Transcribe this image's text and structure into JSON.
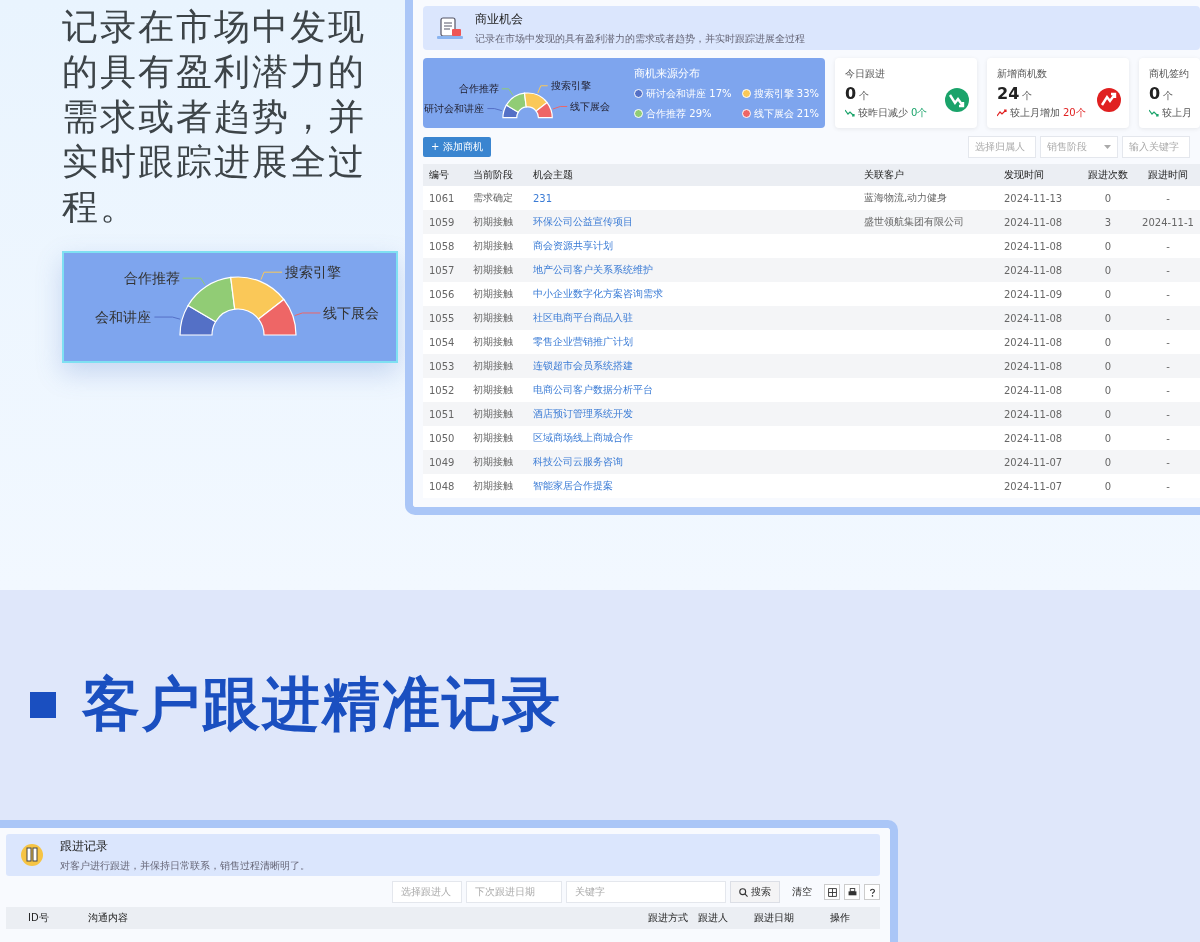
{
  "intro": {
    "text": "记录在市场中发现的具有盈利潜力的需求或者趋势，并实时跟踪进展全过程。"
  },
  "zoom_chart": {
    "slices": [
      {
        "color": "#5470c6"
      },
      {
        "color": "#91cc75"
      },
      {
        "color": "#fac858"
      },
      {
        "color": "#ee6666"
      }
    ],
    "chart_data": {
      "type": "donut",
      "categories": [
        "会和讲座",
        "合作推荐",
        "搜索引擎",
        "线下展会"
      ],
      "values": [
        17,
        29,
        33,
        21
      ]
    }
  },
  "opportunity_panel": {
    "title": "商业机会",
    "description": "记录在市场中发现的具有盈利潜力的需求或者趋势，并实时跟踪进展全过程",
    "source_chart": {
      "chart_data": {
        "type": "donut",
        "title": "商机来源分布",
        "categories": [
          "研讨会和讲座",
          "合作推荐",
          "搜索引擎",
          "线下展会"
        ],
        "values": [
          17,
          29,
          33,
          21
        ]
      },
      "legend": [
        {
          "label": "研讨会和讲座 17%",
          "color": "#5470c6"
        },
        {
          "label": "合作推荐 29%",
          "color": "#91cc75"
        },
        {
          "label": "搜索引擎 33%",
          "color": "#fac858"
        },
        {
          "label": "线下展会 21%",
          "color": "#ee6666"
        }
      ]
    },
    "stats": [
      {
        "title": "今日跟进",
        "value": "0",
        "unit": "个",
        "rising": false,
        "comparison": "较昨日减少",
        "change": "0个"
      },
      {
        "title": "新增商机数",
        "value": "24",
        "unit": "个",
        "rising": true,
        "comparison": "较上月增加",
        "change": "20个"
      },
      {
        "title": "商机签约",
        "value": "0",
        "unit": "个",
        "rising": false,
        "comparison": "较上月"
      }
    ],
    "add_button": "+ 添加商机",
    "filters": [
      {
        "kind": "input",
        "placeholder": "选择归属人"
      },
      {
        "kind": "select",
        "placeholder": "销售阶段"
      },
      {
        "kind": "input",
        "placeholder": "输入关键字"
      }
    ],
    "table": {
      "columns": [
        "编号",
        "当前阶段",
        "机会主题",
        "关联客户",
        "发现时间",
        "跟进次数",
        "跟进时间"
      ],
      "rows": [
        [
          "1061",
          "需求确定",
          "231",
          "蓝海物流,动力健身",
          "2024-11-13",
          "0",
          "-"
        ],
        [
          "1059",
          "初期接触",
          "环保公司公益宣传项目",
          "盛世领航集团有限公司",
          "2024-11-08",
          "3",
          "2024-11-1"
        ],
        [
          "1058",
          "初期接触",
          "商会资源共享计划",
          "",
          "2024-11-08",
          "0",
          "-"
        ],
        [
          "1057",
          "初期接触",
          "地产公司客户关系系统维护",
          "",
          "2024-11-08",
          "0",
          "-"
        ],
        [
          "1056",
          "初期接触",
          "中小企业数字化方案咨询需求",
          "",
          "2024-11-09",
          "0",
          "-"
        ],
        [
          "1055",
          "初期接触",
          "社区电商平台商品入驻",
          "",
          "2024-11-08",
          "0",
          "-"
        ],
        [
          "1054",
          "初期接触",
          "零售企业营销推广计划",
          "",
          "2024-11-08",
          "0",
          "-"
        ],
        [
          "1053",
          "初期接触",
          "连锁超市会员系统搭建",
          "",
          "2024-11-08",
          "0",
          "-"
        ],
        [
          "1052",
          "初期接触",
          "电商公司客户数据分析平台",
          "",
          "2024-11-08",
          "0",
          "-"
        ],
        [
          "1051",
          "初期接触",
          "酒店预订管理系统开发",
          "",
          "2024-11-08",
          "0",
          "-"
        ],
        [
          "1050",
          "初期接触",
          "区域商场线上商城合作",
          "",
          "2024-11-08",
          "0",
          "-"
        ],
        [
          "1049",
          "初期接触",
          "科技公司云服务咨询",
          "",
          "2024-11-07",
          "0",
          "-"
        ],
        [
          "1048",
          "初期接触",
          "智能家居合作提案",
          "",
          "2024-11-07",
          "0",
          "-"
        ]
      ]
    }
  },
  "section_title": "客户跟进精准记录",
  "followup_panel": {
    "title": "跟进记录",
    "description": "对客户进行跟进，并保持日常联系，销售过程清晰明了。",
    "filters": [
      {
        "placeholder": "选择跟进人"
      },
      {
        "placeholder": "下次跟进日期"
      },
      {
        "placeholder": "关键字"
      }
    ],
    "search_button": "搜索",
    "clear_link": "清空",
    "columns": [
      "ID号",
      "沟通内容",
      "跟进方式",
      "跟进人",
      "跟进日期",
      "操作"
    ]
  }
}
